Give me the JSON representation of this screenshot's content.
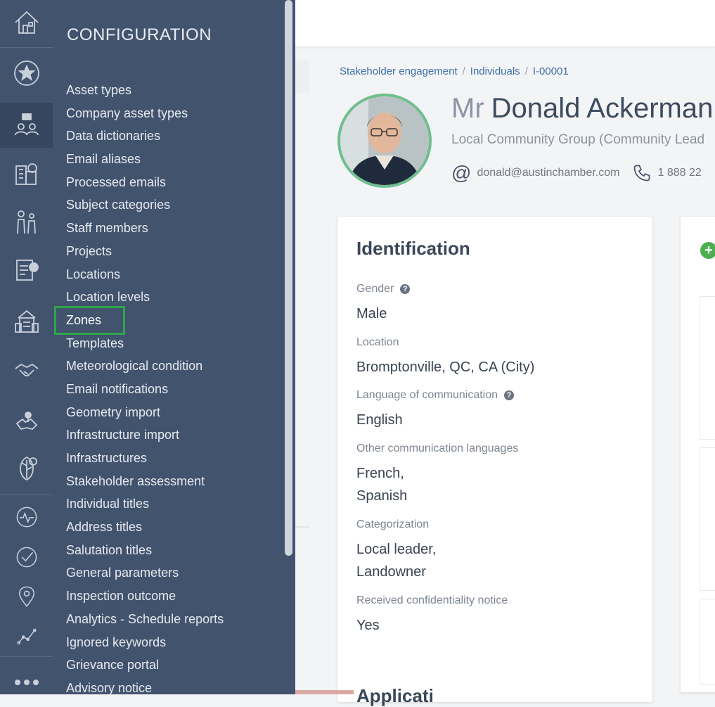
{
  "drawer": {
    "title": "CONFIGURATION",
    "items": [
      "Asset types",
      "Company asset types",
      "Data dictionaries",
      "Email aliases",
      "Processed emails",
      "Subject categories",
      "Staff members",
      "Projects",
      "Locations",
      "Location levels",
      "Zones",
      "Templates",
      "Meteorological condition",
      "Email notifications",
      "Geometry import",
      "Infrastructure import",
      "Infrastructures",
      "Stakeholder assessment",
      "Individual titles",
      "Address titles",
      "Salutation titles",
      "General parameters",
      "Inspection outcome",
      "Analytics - Schedule reports",
      "Ignored keywords",
      "Grievance portal",
      "Advisory notice"
    ],
    "selected": "Zones"
  },
  "rail": {
    "icons": [
      "home-icon",
      "favorites-icon",
      "stakeholders-icon",
      "buildings-icon",
      "people-icon",
      "tasks-icon",
      "city-icon",
      "handshake-icon",
      "map-icon",
      "environment-icon",
      "activity-icon",
      "check-icon",
      "location-icon",
      "analytics-icon",
      "more-icon"
    ]
  },
  "breadcrumb": {
    "items": [
      "Stakeholder engagement",
      "Individuals",
      "I-00001"
    ],
    "separator": "/"
  },
  "profile": {
    "salutation": "Mr",
    "name": "Donald Ackerman",
    "organization": "Local Community Group (Community Lead",
    "email": "donald@austinchamber.com",
    "phone": "1 888 22",
    "accent": "#6fbf8e"
  },
  "identification": {
    "title": "Identification",
    "gender_label": "Gender",
    "gender_value": "Male",
    "location_label": "Location",
    "location_value": "Bromptonville, QC, CA (City)",
    "language_label": "Language of communication",
    "language_value": "English",
    "other_lang_label": "Other communication languages",
    "other_lang_1": "French,",
    "other_lang_2": "Spanish",
    "categorization_label": "Categorization",
    "categorization_1": "Local leader,",
    "categorization_2": "Landowner",
    "confidentiality_label": "Received confidentiality notice",
    "confidentiality_value": "Yes",
    "next_section": "Applicati"
  },
  "colors": {
    "sidebar": "#42536e",
    "highlight": "#2ea64b",
    "link": "#3c6fa8"
  }
}
